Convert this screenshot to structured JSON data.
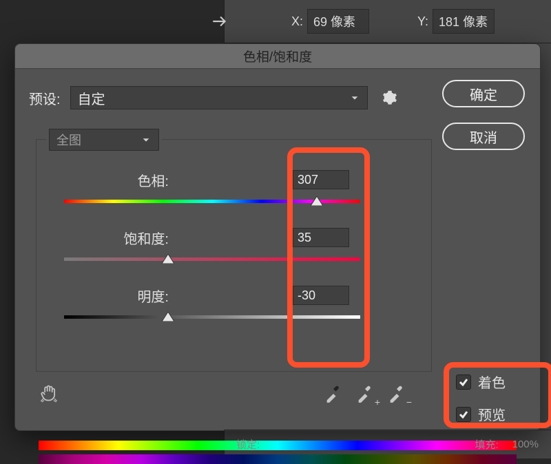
{
  "host": {
    "x_label": "X:",
    "x_value": "69 像素",
    "y_label": "Y:",
    "y_value": "181 像素",
    "bottom_lock": "锁定:",
    "bottom_fill": "填充:",
    "bottom_pct": "100%"
  },
  "dialog": {
    "title": "色相/饱和度",
    "preset_label": "预设:",
    "preset_value": "自定",
    "ok": "确定",
    "cancel": "取消",
    "range_value": "全图",
    "hue_label": "色相:",
    "hue_value": "307",
    "sat_label": "饱和度:",
    "sat_value": "35",
    "lig_label": "明度:",
    "lig_value": "-30",
    "colorize": "着色",
    "preview": "预览"
  },
  "chart_data": {
    "type": "table",
    "title": "色相/饱和度",
    "rows": [
      {
        "param": "色相",
        "value": 307,
        "min": 0,
        "max": 360
      },
      {
        "param": "饱和度",
        "value": 35,
        "min": -100,
        "max": 100
      },
      {
        "param": "明度",
        "value": -30,
        "min": -100,
        "max": 100
      }
    ],
    "flags": {
      "着色": true,
      "预览": true
    },
    "preset": "自定",
    "range": "全图"
  }
}
